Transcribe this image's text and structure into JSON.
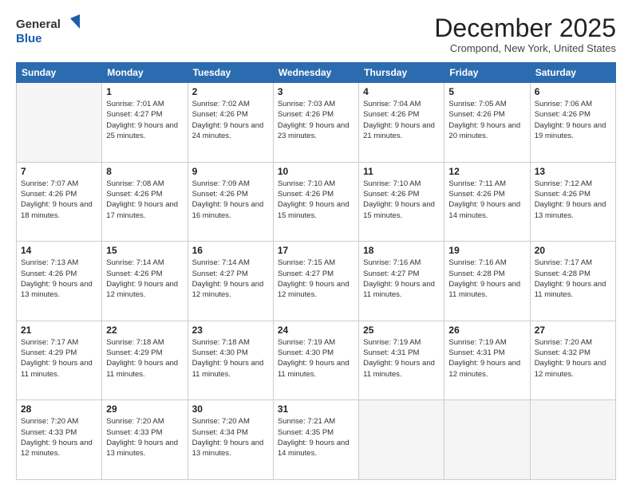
{
  "header": {
    "logo_line1": "General",
    "logo_line2": "Blue",
    "month": "December 2025",
    "location": "Crompond, New York, United States"
  },
  "days_of_week": [
    "Sunday",
    "Monday",
    "Tuesday",
    "Wednesday",
    "Thursday",
    "Friday",
    "Saturday"
  ],
  "weeks": [
    [
      {
        "day": "",
        "sunrise": "",
        "sunset": "",
        "daylight": ""
      },
      {
        "day": "1",
        "sunrise": "Sunrise: 7:01 AM",
        "sunset": "Sunset: 4:27 PM",
        "daylight": "Daylight: 9 hours and 25 minutes."
      },
      {
        "day": "2",
        "sunrise": "Sunrise: 7:02 AM",
        "sunset": "Sunset: 4:26 PM",
        "daylight": "Daylight: 9 hours and 24 minutes."
      },
      {
        "day": "3",
        "sunrise": "Sunrise: 7:03 AM",
        "sunset": "Sunset: 4:26 PM",
        "daylight": "Daylight: 9 hours and 23 minutes."
      },
      {
        "day": "4",
        "sunrise": "Sunrise: 7:04 AM",
        "sunset": "Sunset: 4:26 PM",
        "daylight": "Daylight: 9 hours and 21 minutes."
      },
      {
        "day": "5",
        "sunrise": "Sunrise: 7:05 AM",
        "sunset": "Sunset: 4:26 PM",
        "daylight": "Daylight: 9 hours and 20 minutes."
      },
      {
        "day": "6",
        "sunrise": "Sunrise: 7:06 AM",
        "sunset": "Sunset: 4:26 PM",
        "daylight": "Daylight: 9 hours and 19 minutes."
      }
    ],
    [
      {
        "day": "7",
        "sunrise": "Sunrise: 7:07 AM",
        "sunset": "Sunset: 4:26 PM",
        "daylight": "Daylight: 9 hours and 18 minutes."
      },
      {
        "day": "8",
        "sunrise": "Sunrise: 7:08 AM",
        "sunset": "Sunset: 4:26 PM",
        "daylight": "Daylight: 9 hours and 17 minutes."
      },
      {
        "day": "9",
        "sunrise": "Sunrise: 7:09 AM",
        "sunset": "Sunset: 4:26 PM",
        "daylight": "Daylight: 9 hours and 16 minutes."
      },
      {
        "day": "10",
        "sunrise": "Sunrise: 7:10 AM",
        "sunset": "Sunset: 4:26 PM",
        "daylight": "Daylight: 9 hours and 15 minutes."
      },
      {
        "day": "11",
        "sunrise": "Sunrise: 7:10 AM",
        "sunset": "Sunset: 4:26 PM",
        "daylight": "Daylight: 9 hours and 15 minutes."
      },
      {
        "day": "12",
        "sunrise": "Sunrise: 7:11 AM",
        "sunset": "Sunset: 4:26 PM",
        "daylight": "Daylight: 9 hours and 14 minutes."
      },
      {
        "day": "13",
        "sunrise": "Sunrise: 7:12 AM",
        "sunset": "Sunset: 4:26 PM",
        "daylight": "Daylight: 9 hours and 13 minutes."
      }
    ],
    [
      {
        "day": "14",
        "sunrise": "Sunrise: 7:13 AM",
        "sunset": "Sunset: 4:26 PM",
        "daylight": "Daylight: 9 hours and 13 minutes."
      },
      {
        "day": "15",
        "sunrise": "Sunrise: 7:14 AM",
        "sunset": "Sunset: 4:26 PM",
        "daylight": "Daylight: 9 hours and 12 minutes."
      },
      {
        "day": "16",
        "sunrise": "Sunrise: 7:14 AM",
        "sunset": "Sunset: 4:27 PM",
        "daylight": "Daylight: 9 hours and 12 minutes."
      },
      {
        "day": "17",
        "sunrise": "Sunrise: 7:15 AM",
        "sunset": "Sunset: 4:27 PM",
        "daylight": "Daylight: 9 hours and 12 minutes."
      },
      {
        "day": "18",
        "sunrise": "Sunrise: 7:16 AM",
        "sunset": "Sunset: 4:27 PM",
        "daylight": "Daylight: 9 hours and 11 minutes."
      },
      {
        "day": "19",
        "sunrise": "Sunrise: 7:16 AM",
        "sunset": "Sunset: 4:28 PM",
        "daylight": "Daylight: 9 hours and 11 minutes."
      },
      {
        "day": "20",
        "sunrise": "Sunrise: 7:17 AM",
        "sunset": "Sunset: 4:28 PM",
        "daylight": "Daylight: 9 hours and 11 minutes."
      }
    ],
    [
      {
        "day": "21",
        "sunrise": "Sunrise: 7:17 AM",
        "sunset": "Sunset: 4:29 PM",
        "daylight": "Daylight: 9 hours and 11 minutes."
      },
      {
        "day": "22",
        "sunrise": "Sunrise: 7:18 AM",
        "sunset": "Sunset: 4:29 PM",
        "daylight": "Daylight: 9 hours and 11 minutes."
      },
      {
        "day": "23",
        "sunrise": "Sunrise: 7:18 AM",
        "sunset": "Sunset: 4:30 PM",
        "daylight": "Daylight: 9 hours and 11 minutes."
      },
      {
        "day": "24",
        "sunrise": "Sunrise: 7:19 AM",
        "sunset": "Sunset: 4:30 PM",
        "daylight": "Daylight: 9 hours and 11 minutes."
      },
      {
        "day": "25",
        "sunrise": "Sunrise: 7:19 AM",
        "sunset": "Sunset: 4:31 PM",
        "daylight": "Daylight: 9 hours and 11 minutes."
      },
      {
        "day": "26",
        "sunrise": "Sunrise: 7:19 AM",
        "sunset": "Sunset: 4:31 PM",
        "daylight": "Daylight: 9 hours and 12 minutes."
      },
      {
        "day": "27",
        "sunrise": "Sunrise: 7:20 AM",
        "sunset": "Sunset: 4:32 PM",
        "daylight": "Daylight: 9 hours and 12 minutes."
      }
    ],
    [
      {
        "day": "28",
        "sunrise": "Sunrise: 7:20 AM",
        "sunset": "Sunset: 4:33 PM",
        "daylight": "Daylight: 9 hours and 12 minutes."
      },
      {
        "day": "29",
        "sunrise": "Sunrise: 7:20 AM",
        "sunset": "Sunset: 4:33 PM",
        "daylight": "Daylight: 9 hours and 13 minutes."
      },
      {
        "day": "30",
        "sunrise": "Sunrise: 7:20 AM",
        "sunset": "Sunset: 4:34 PM",
        "daylight": "Daylight: 9 hours and 13 minutes."
      },
      {
        "day": "31",
        "sunrise": "Sunrise: 7:21 AM",
        "sunset": "Sunset: 4:35 PM",
        "daylight": "Daylight: 9 hours and 14 minutes."
      },
      {
        "day": "",
        "sunrise": "",
        "sunset": "",
        "daylight": ""
      },
      {
        "day": "",
        "sunrise": "",
        "sunset": "",
        "daylight": ""
      },
      {
        "day": "",
        "sunrise": "",
        "sunset": "",
        "daylight": ""
      }
    ]
  ]
}
